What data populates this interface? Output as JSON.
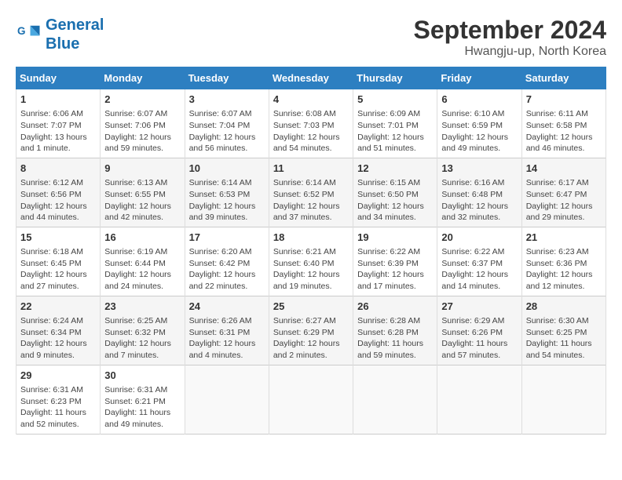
{
  "logo": {
    "line1": "General",
    "line2": "Blue"
  },
  "title": "September 2024",
  "location": "Hwangju-up, North Korea",
  "weekdays": [
    "Sunday",
    "Monday",
    "Tuesday",
    "Wednesday",
    "Thursday",
    "Friday",
    "Saturday"
  ],
  "weeks": [
    [
      {
        "day": 1,
        "sunrise": "6:06 AM",
        "sunset": "7:07 PM",
        "daylight": "13 hours and 1 minute."
      },
      {
        "day": 2,
        "sunrise": "6:07 AM",
        "sunset": "7:06 PM",
        "daylight": "12 hours and 59 minutes."
      },
      {
        "day": 3,
        "sunrise": "6:07 AM",
        "sunset": "7:04 PM",
        "daylight": "12 hours and 56 minutes."
      },
      {
        "day": 4,
        "sunrise": "6:08 AM",
        "sunset": "7:03 PM",
        "daylight": "12 hours and 54 minutes."
      },
      {
        "day": 5,
        "sunrise": "6:09 AM",
        "sunset": "7:01 PM",
        "daylight": "12 hours and 51 minutes."
      },
      {
        "day": 6,
        "sunrise": "6:10 AM",
        "sunset": "6:59 PM",
        "daylight": "12 hours and 49 minutes."
      },
      {
        "day": 7,
        "sunrise": "6:11 AM",
        "sunset": "6:58 PM",
        "daylight": "12 hours and 46 minutes."
      }
    ],
    [
      {
        "day": 8,
        "sunrise": "6:12 AM",
        "sunset": "6:56 PM",
        "daylight": "12 hours and 44 minutes."
      },
      {
        "day": 9,
        "sunrise": "6:13 AM",
        "sunset": "6:55 PM",
        "daylight": "12 hours and 42 minutes."
      },
      {
        "day": 10,
        "sunrise": "6:14 AM",
        "sunset": "6:53 PM",
        "daylight": "12 hours and 39 minutes."
      },
      {
        "day": 11,
        "sunrise": "6:14 AM",
        "sunset": "6:52 PM",
        "daylight": "12 hours and 37 minutes."
      },
      {
        "day": 12,
        "sunrise": "6:15 AM",
        "sunset": "6:50 PM",
        "daylight": "12 hours and 34 minutes."
      },
      {
        "day": 13,
        "sunrise": "6:16 AM",
        "sunset": "6:48 PM",
        "daylight": "12 hours and 32 minutes."
      },
      {
        "day": 14,
        "sunrise": "6:17 AM",
        "sunset": "6:47 PM",
        "daylight": "12 hours and 29 minutes."
      }
    ],
    [
      {
        "day": 15,
        "sunrise": "6:18 AM",
        "sunset": "6:45 PM",
        "daylight": "12 hours and 27 minutes."
      },
      {
        "day": 16,
        "sunrise": "6:19 AM",
        "sunset": "6:44 PM",
        "daylight": "12 hours and 24 minutes."
      },
      {
        "day": 17,
        "sunrise": "6:20 AM",
        "sunset": "6:42 PM",
        "daylight": "12 hours and 22 minutes."
      },
      {
        "day": 18,
        "sunrise": "6:21 AM",
        "sunset": "6:40 PM",
        "daylight": "12 hours and 19 minutes."
      },
      {
        "day": 19,
        "sunrise": "6:22 AM",
        "sunset": "6:39 PM",
        "daylight": "12 hours and 17 minutes."
      },
      {
        "day": 20,
        "sunrise": "6:22 AM",
        "sunset": "6:37 PM",
        "daylight": "12 hours and 14 minutes."
      },
      {
        "day": 21,
        "sunrise": "6:23 AM",
        "sunset": "6:36 PM",
        "daylight": "12 hours and 12 minutes."
      }
    ],
    [
      {
        "day": 22,
        "sunrise": "6:24 AM",
        "sunset": "6:34 PM",
        "daylight": "12 hours and 9 minutes."
      },
      {
        "day": 23,
        "sunrise": "6:25 AM",
        "sunset": "6:32 PM",
        "daylight": "12 hours and 7 minutes."
      },
      {
        "day": 24,
        "sunrise": "6:26 AM",
        "sunset": "6:31 PM",
        "daylight": "12 hours and 4 minutes."
      },
      {
        "day": 25,
        "sunrise": "6:27 AM",
        "sunset": "6:29 PM",
        "daylight": "12 hours and 2 minutes."
      },
      {
        "day": 26,
        "sunrise": "6:28 AM",
        "sunset": "6:28 PM",
        "daylight": "11 hours and 59 minutes."
      },
      {
        "day": 27,
        "sunrise": "6:29 AM",
        "sunset": "6:26 PM",
        "daylight": "11 hours and 57 minutes."
      },
      {
        "day": 28,
        "sunrise": "6:30 AM",
        "sunset": "6:25 PM",
        "daylight": "11 hours and 54 minutes."
      }
    ],
    [
      {
        "day": 29,
        "sunrise": "6:31 AM",
        "sunset": "6:23 PM",
        "daylight": "11 hours and 52 minutes."
      },
      {
        "day": 30,
        "sunrise": "6:31 AM",
        "sunset": "6:21 PM",
        "daylight": "11 hours and 49 minutes."
      },
      null,
      null,
      null,
      null,
      null
    ]
  ]
}
